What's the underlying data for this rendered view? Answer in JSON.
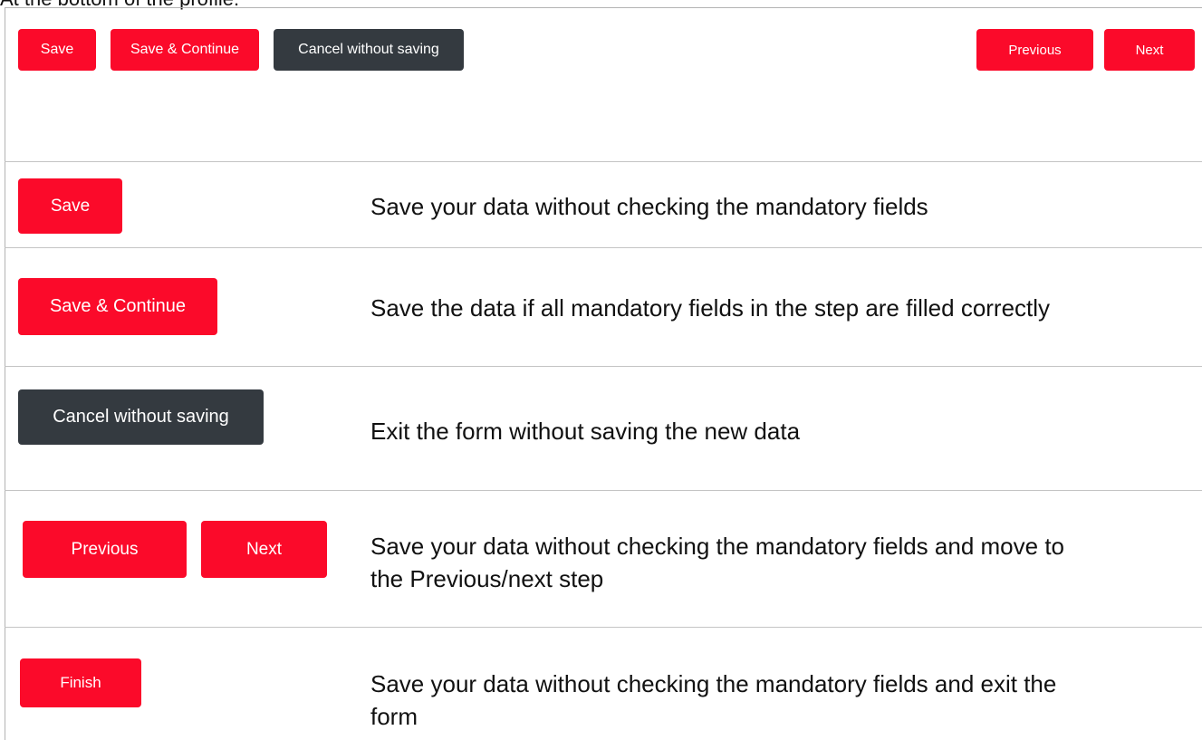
{
  "intro_text": "At the bottom of the profile:",
  "toolbar": {
    "save_label": "Save",
    "save_continue_label": "Save & Continue",
    "cancel_label": "Cancel without saving",
    "previous_label": "Previous",
    "next_label": "Next"
  },
  "rows": [
    {
      "buttons": [
        "Save"
      ],
      "description": "Save your data without checking the mandatory fields"
    },
    {
      "buttons": [
        "Save & Continue"
      ],
      "description": "Save the data if all mandatory fields in the step are filled correctly"
    },
    {
      "buttons": [
        "Cancel without saving"
      ],
      "description": "Exit the form without saving the new data"
    },
    {
      "buttons": [
        "Previous",
        "Next"
      ],
      "description_line1": "Save your data without checking the mandatory fields and move to",
      "description_line2": "the Previous/next step"
    },
    {
      "buttons": [
        "Finish"
      ],
      "description_line1": "Save your data without checking the mandatory fields and exit the",
      "description_line2": "form"
    }
  ],
  "colors": {
    "primary_red": "#fb0a2a",
    "dark_gray": "#343a40"
  }
}
